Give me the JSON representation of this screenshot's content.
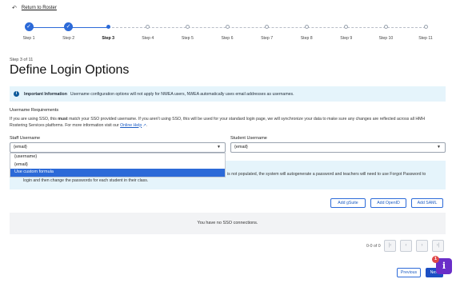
{
  "header": {
    "back_label": "Return to Roster",
    "back_icon": "arrow-left-icon"
  },
  "stepper": {
    "steps": [
      {
        "label": "Step 1",
        "state": "done"
      },
      {
        "label": "Step 2",
        "state": "done"
      },
      {
        "label": "Step 3",
        "state": "current"
      },
      {
        "label": "Step 4",
        "state": "future"
      },
      {
        "label": "Step 5",
        "state": "future"
      },
      {
        "label": "Step 6",
        "state": "future"
      },
      {
        "label": "Step 7",
        "state": "future"
      },
      {
        "label": "Step 8",
        "state": "future"
      },
      {
        "label": "Step 9",
        "state": "future"
      },
      {
        "label": "Step 10",
        "state": "future"
      },
      {
        "label": "Step 11",
        "state": "future"
      }
    ],
    "check_glyph": "✓"
  },
  "page": {
    "step_of": "Step 3 of 11",
    "title": "Define Login Options"
  },
  "info_banner": {
    "icon": "i",
    "heading": "Important Information",
    "text": "Username configuration options will not apply for NWEA users, NWEA automatically uses email addresses as usernames."
  },
  "username_requirements": {
    "title": "Username Requirements",
    "para_pre": "If you are using SSO, this ",
    "para_bold": "must",
    "para_post": " match your SSO provided username. If you aren't using SSO, this will be used for your standard login page, we will synchronize your data to make sure any changes are reflected across all HMH Rostering Services platforms. For more information visit our ",
    "link": "Online Help",
    "link_icon": "external-link-icon"
  },
  "staff_username": {
    "label": "Staff Username",
    "value": "{email}",
    "options": [
      "{username}",
      "{email}",
      "Use custom formula"
    ],
    "selected_index": 2
  },
  "student_username": {
    "label": "Student Username",
    "value": "{email}"
  },
  "password_info": {
    "line1": "is not populated, the system will autogenerate a password and teachers will need to use Forgot Password to",
    "line2": "login and then change the passwords for each student in their class."
  },
  "sso": {
    "buttons": [
      "Add gSuite",
      "Add OpenID",
      "Add SAML"
    ],
    "empty_text": "You have no SSO connections."
  },
  "pagination": {
    "text": "0-0 of 0",
    "first": "|‹",
    "prev": "‹",
    "next": "›",
    "last": "›|"
  },
  "footer": {
    "previous_label": "Previous",
    "next_label": "Next"
  },
  "help_widget": {
    "glyph": "i",
    "badge": "1"
  },
  "colors": {
    "accent": "#2c6ad8",
    "info_bg": "#e5f4fb",
    "help_purple": "#6a2ec8"
  }
}
